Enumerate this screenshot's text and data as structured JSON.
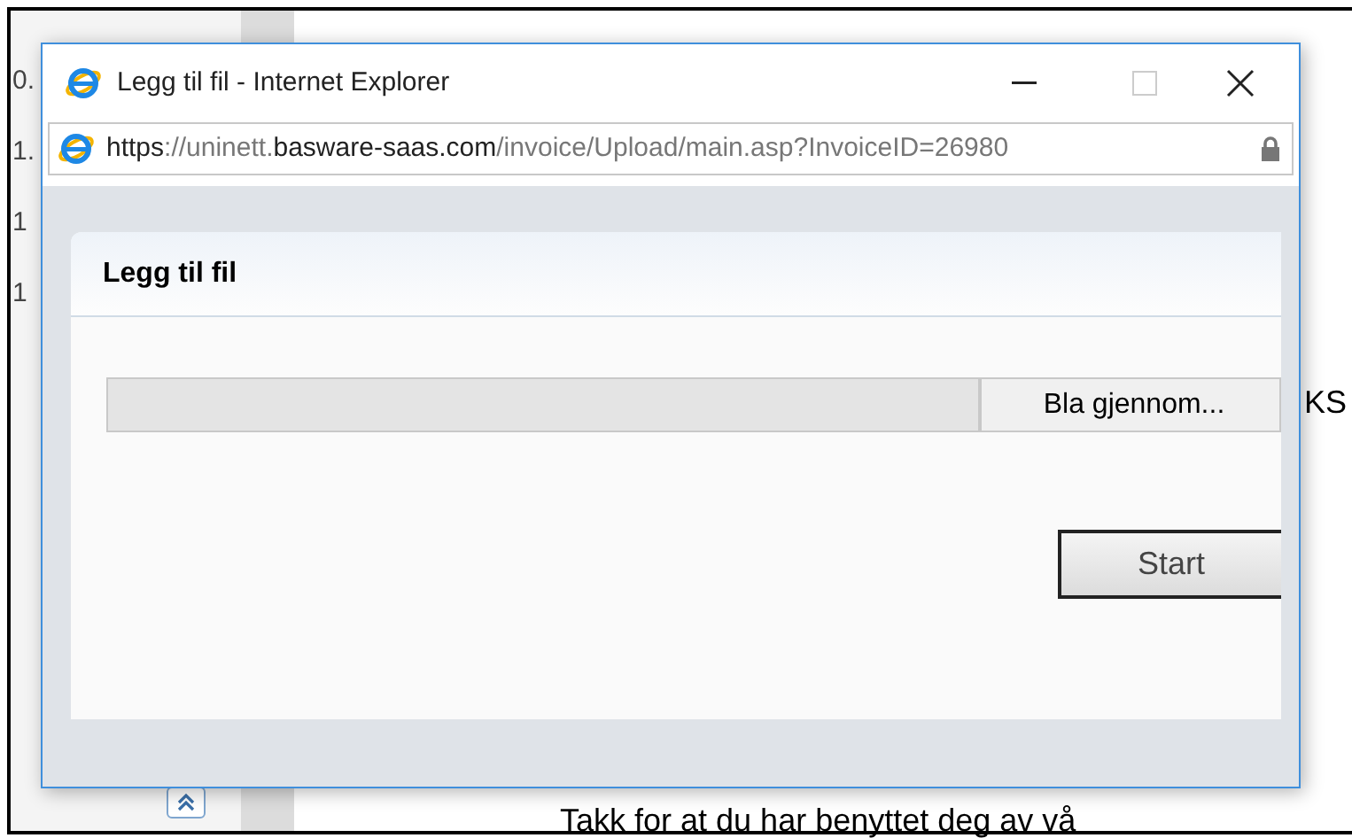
{
  "background": {
    "side_numbers": [
      "0.",
      "1.",
      "1",
      "1"
    ],
    "heading_fragment": "KS",
    "footer_text": "Takk for at du har benyttet deg av vå"
  },
  "window": {
    "title": "Legg til fil - Internet Explorer",
    "address": [
      {
        "text": "https",
        "emphasis": true
      },
      {
        "text": "://uninett.",
        "emphasis": false
      },
      {
        "text": "basware-saas.com",
        "emphasis": true
      },
      {
        "text": "/invoice/Upload/main.asp?InvoiceID=26980",
        "emphasis": false
      }
    ]
  },
  "dialog": {
    "title": "Legg til fil",
    "browse_button": "Bla gjennom...",
    "start_button": "Start"
  }
}
